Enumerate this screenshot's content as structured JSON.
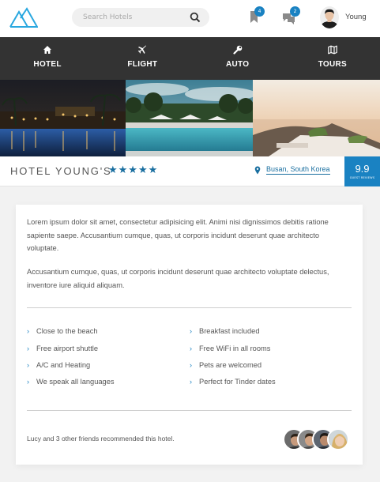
{
  "header": {
    "search_placeholder": "Search Hotels",
    "bookmarks_count": "4",
    "messages_count": "2",
    "username": "Young"
  },
  "nav": {
    "items": [
      {
        "label": "HOTEL",
        "icon": "home-icon"
      },
      {
        "label": "FLIGHT",
        "icon": "plane-icon"
      },
      {
        "label": "AUTO",
        "icon": "wrench-icon"
      },
      {
        "label": "TOURS",
        "icon": "map-icon"
      }
    ]
  },
  "hotel": {
    "name": "HOTEL YOUNG'S",
    "stars": "★★★★★",
    "rating_value": 5,
    "location": "Busan, South Korea",
    "score": "9.9",
    "score_label": "GUEST REVIEWS"
  },
  "description": {
    "paragraph1": "Lorem ipsum dolor sit amet, consectetur adipisicing elit. Animi nisi dignissimos debitis ratione sapiente saepe. Accusantium cumque, quas, ut corporis incidunt deserunt quae architecto voluptate.",
    "paragraph2": "Accusantium cumque, quas, ut corporis incidunt deserunt quae architecto voluptate delectus, inventore iure aliquid aliquam."
  },
  "features": [
    "Close to the beach",
    "Breakfast included",
    "Free airport shuttle",
    "Free WiFi in all rooms",
    "A/C and Heating",
    "Pets are welcomed",
    "We speak all languages",
    "Perfect for Tinder dates"
  ],
  "friends_text": "Lucy and 3 other friends recommended this hotel.",
  "colors": {
    "accent": "#1a82c2",
    "nav_bg": "#333333",
    "star": "#1a6fa0"
  }
}
